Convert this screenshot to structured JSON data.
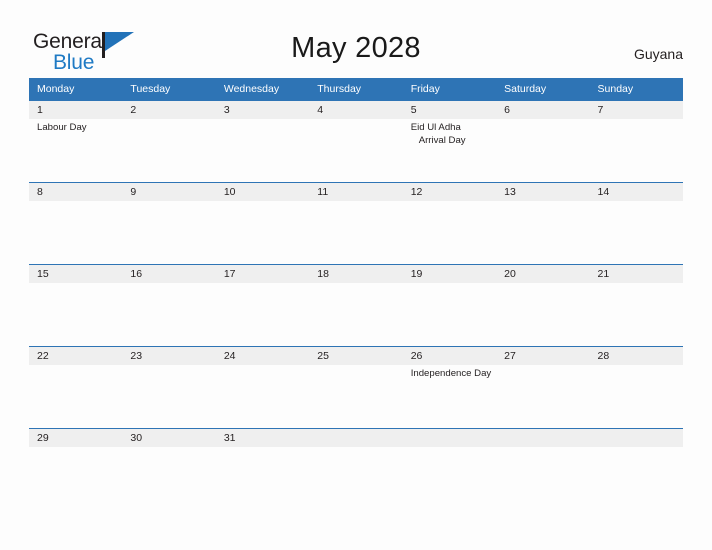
{
  "brand": {
    "name_dark": "General",
    "name_blue": "Blue",
    "flag_icon": "flag-triangle-icon"
  },
  "header": {
    "title": "May 2028",
    "country": "Guyana"
  },
  "colors": {
    "header_blue": "#2e74b5",
    "row_band_gray": "#efefef",
    "logo_blue": "#1f7ac4",
    "text_dark": "#231f20",
    "page_background": "#fdfdfd"
  },
  "calendar": {
    "weekday_headers": [
      "Monday",
      "Tuesday",
      "Wednesday",
      "Thursday",
      "Friday",
      "Saturday",
      "Sunday"
    ],
    "weeks": [
      [
        {
          "day": "1",
          "events": [
            {
              "text": "Labour Day",
              "indent": false
            }
          ]
        },
        {
          "day": "2",
          "events": []
        },
        {
          "day": "3",
          "events": []
        },
        {
          "day": "4",
          "events": []
        },
        {
          "day": "5",
          "events": [
            {
              "text": "Eid Ul Adha",
              "indent": false
            },
            {
              "text": "Arrival Day",
              "indent": true
            }
          ]
        },
        {
          "day": "6",
          "events": []
        },
        {
          "day": "7",
          "events": []
        }
      ],
      [
        {
          "day": "8",
          "events": []
        },
        {
          "day": "9",
          "events": []
        },
        {
          "day": "10",
          "events": []
        },
        {
          "day": "11",
          "events": []
        },
        {
          "day": "12",
          "events": []
        },
        {
          "day": "13",
          "events": []
        },
        {
          "day": "14",
          "events": []
        }
      ],
      [
        {
          "day": "15",
          "events": []
        },
        {
          "day": "16",
          "events": []
        },
        {
          "day": "17",
          "events": []
        },
        {
          "day": "18",
          "events": []
        },
        {
          "day": "19",
          "events": []
        },
        {
          "day": "20",
          "events": []
        },
        {
          "day": "21",
          "events": []
        }
      ],
      [
        {
          "day": "22",
          "events": []
        },
        {
          "day": "23",
          "events": []
        },
        {
          "day": "24",
          "events": []
        },
        {
          "day": "25",
          "events": []
        },
        {
          "day": "26",
          "events": [
            {
              "text": "Independence Day",
              "indent": false
            }
          ]
        },
        {
          "day": "27",
          "events": []
        },
        {
          "day": "28",
          "events": []
        }
      ],
      [
        {
          "day": "29",
          "events": []
        },
        {
          "day": "30",
          "events": []
        },
        {
          "day": "31",
          "events": []
        },
        {
          "day": "",
          "events": []
        },
        {
          "day": "",
          "events": []
        },
        {
          "day": "",
          "events": []
        },
        {
          "day": "",
          "events": []
        }
      ]
    ]
  }
}
